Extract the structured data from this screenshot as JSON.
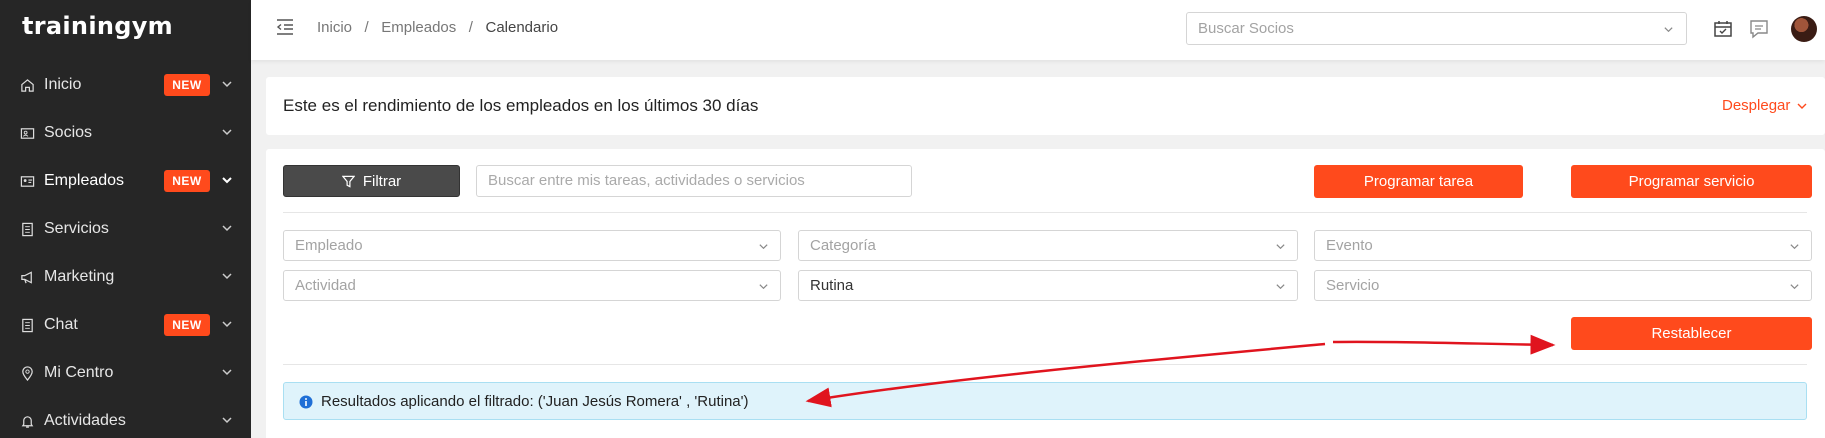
{
  "app": {
    "logo": "trainingym"
  },
  "sidebar": {
    "items": [
      {
        "label": "Inicio",
        "badge": "NEW",
        "icon": "home-icon"
      },
      {
        "label": "Socios",
        "badge": "",
        "icon": "id-card-icon"
      },
      {
        "label": "Empleados",
        "badge": "NEW",
        "icon": "employee-card-icon"
      },
      {
        "label": "Servicios",
        "badge": "",
        "icon": "document-icon"
      },
      {
        "label": "Marketing",
        "badge": "",
        "icon": "megaphone-icon"
      },
      {
        "label": "Chat",
        "badge": "NEW",
        "icon": "document-icon"
      },
      {
        "label": "Mi Centro",
        "badge": "",
        "icon": "location-pin-icon"
      },
      {
        "label": "Actividades",
        "badge": "",
        "icon": "bell-icon"
      }
    ]
  },
  "topbar": {
    "breadcrumb": {
      "b1": "Inicio",
      "b2": "Empleados",
      "b3": "Calendario",
      "sep": "/"
    },
    "search_placeholder": "Buscar Socios"
  },
  "banner": {
    "message": "Este es el rendimiento de los empleados en los últimos 30 días",
    "toggle_label": "Desplegar"
  },
  "filters": {
    "filter_button": "Filtrar",
    "search_placeholder": "Buscar entre mis tareas, actividades o servicios",
    "schedule_task": "Programar tarea",
    "schedule_service": "Programar servicio",
    "empleado": "Empleado",
    "categoria": "Categoría",
    "evento": "Evento",
    "actividad": "Actividad",
    "rutina": "Rutina",
    "servicio": "Servicio",
    "reset": "Restablecer"
  },
  "info": {
    "text": "Resultados aplicando el filtrado: ('Juan Jesús Romera' , 'Rutina')"
  },
  "colors": {
    "accent": "#ff4a1c",
    "sidebar_bg": "#262626",
    "info_bg": "#dff3fb",
    "annotation_arrow": "#e0141e"
  }
}
